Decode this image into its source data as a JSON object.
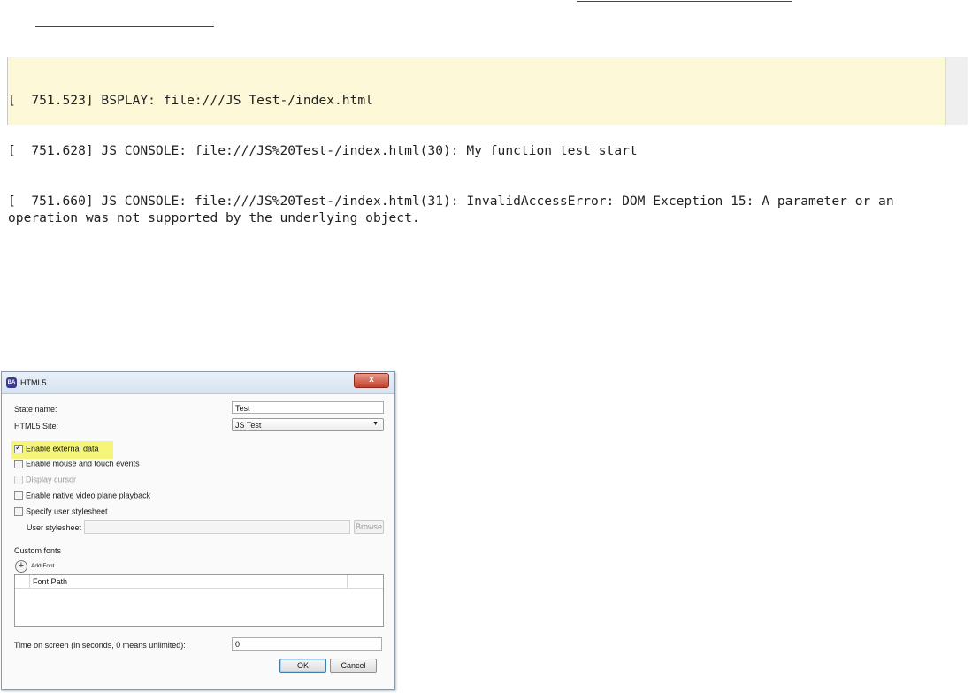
{
  "console": {
    "lines": [
      "[  751.523] BSPLAY: file:///JS Test-/index.html",
      "[  751.628] JS CONSOLE: file:///JS%20Test-/index.html(30): My function test start",
      "[  751.660] JS CONSOLE: file:///JS%20Test-/index.html(31): InvalidAccessError: DOM Exception 15: A parameter or an operation was not supported by the underlying object."
    ]
  },
  "dialog": {
    "title": "HTML5",
    "close_glyph": "x",
    "state_name_label": "State name:",
    "state_name_value": "Test",
    "site_label": "HTML5 Site:",
    "site_value": "JS Test",
    "options": {
      "enable_external_data": {
        "label": "Enable external data",
        "checked": true
      },
      "enable_mouse_touch": {
        "label": "Enable mouse and touch events",
        "checked": false
      },
      "display_cursor": {
        "label": "Display cursor",
        "checked": false,
        "disabled": true
      },
      "native_video": {
        "label": "Enable native video plane playback",
        "checked": false
      },
      "user_stylesheet": {
        "label": "Specify user stylesheet",
        "checked": false
      }
    },
    "stylesheet_label": "User stylesheet",
    "stylesheet_value": "",
    "browse_label": "Browse",
    "custom_fonts_label": "Custom fonts",
    "add_font_label": "Add Font",
    "font_table": {
      "columns": [
        "Font Path"
      ],
      "rows": []
    },
    "time_label": "Time on screen (in seconds, 0 means unlimited):",
    "time_value": "0",
    "ok_label": "OK",
    "cancel_label": "Cancel"
  }
}
